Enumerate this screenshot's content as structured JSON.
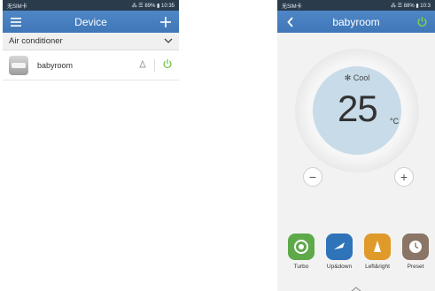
{
  "left": {
    "status": {
      "carrier": "无SIM卡",
      "right": "⁂ ☰ 89% ▮ 10:35"
    },
    "header": {
      "title": "Device"
    },
    "section": {
      "label": "Air conditioner"
    },
    "devices": [
      {
        "name": "babyroom"
      }
    ]
  },
  "right": {
    "status": {
      "carrier": "无SIM卡",
      "right": "⁂ ☰ 88% ▮ 10:3"
    },
    "header": {
      "title": "babyroom"
    },
    "dial": {
      "mode": "Cool",
      "mode_icon": "✻",
      "temperature": "25",
      "unit": "°C"
    },
    "controls": {
      "minus": "−",
      "plus": "+"
    },
    "functions": [
      {
        "label": "Turbo",
        "color": "#5ea94a"
      },
      {
        "label": "Up&down",
        "color": "#2f73b8"
      },
      {
        "label": "Left&right",
        "color": "#e09a2a"
      },
      {
        "label": "Preset",
        "color": "#8a7566"
      }
    ]
  },
  "colors": {
    "header": "#4680c1",
    "status": "#2a3b4c",
    "power_green": "#6bbf3a"
  }
}
